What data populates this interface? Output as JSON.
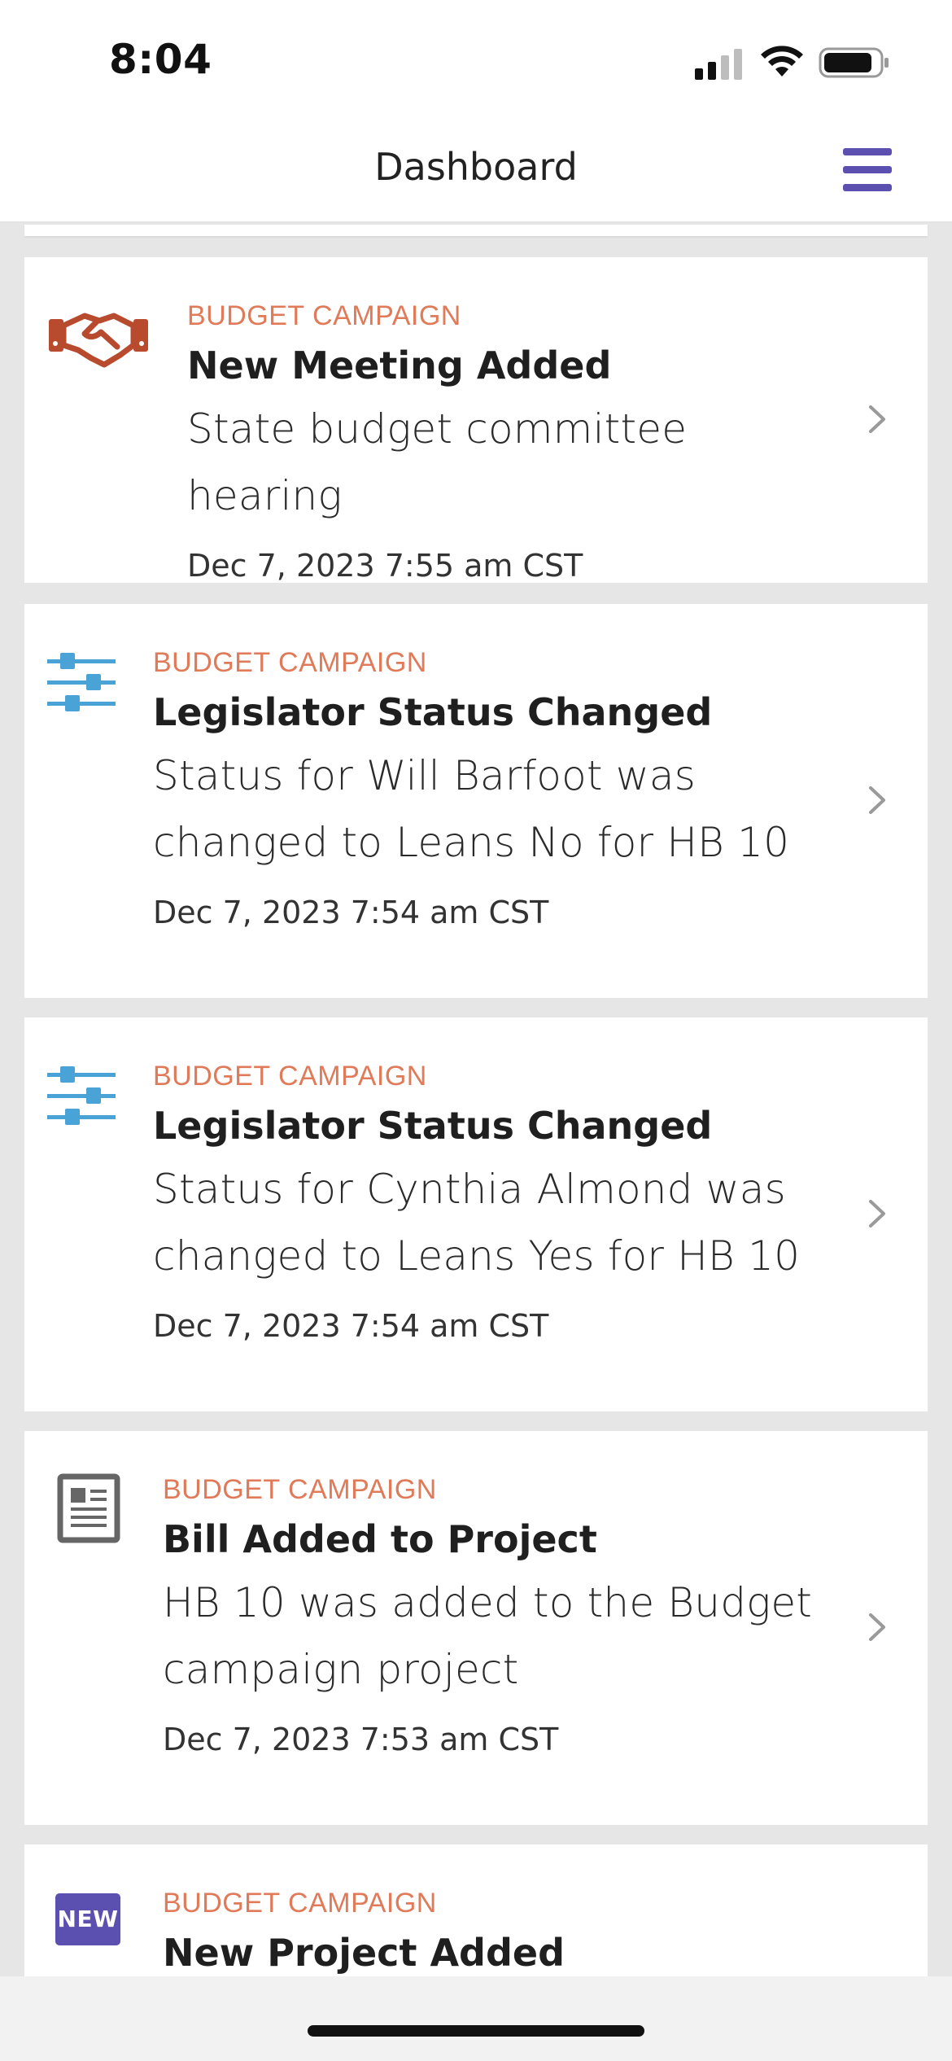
{
  "status_bar": {
    "time": "8:04",
    "icons": [
      "signal-icon",
      "wifi-icon",
      "battery-icon"
    ]
  },
  "nav": {
    "title": "Dashboard",
    "menu_icon": "hamburger-menu-icon",
    "accent_color": "#5b4fb0"
  },
  "feed": {
    "items": [
      {
        "icon": "handshake-icon",
        "category": "BUDGET CAMPAIGN",
        "title": "New Meeting Added",
        "description": "State budget committee hearing",
        "timestamp": "Dec 7, 2023 7:55 am CST"
      },
      {
        "icon": "sliders-icon",
        "category": "BUDGET CAMPAIGN",
        "title": "Legislator Status Changed",
        "description": "Status for Will Barfoot was changed to Leans No for HB 10",
        "timestamp": "Dec 7, 2023 7:54 am CST"
      },
      {
        "icon": "sliders-icon",
        "category": "BUDGET CAMPAIGN",
        "title": "Legislator Status Changed",
        "description": "Status for Cynthia Almond was changed to Leans Yes for HB 10",
        "timestamp": "Dec 7, 2023 7:54 am CST"
      },
      {
        "icon": "document-icon",
        "category": "BUDGET CAMPAIGN",
        "title": "Bill Added to Project",
        "description": "HB 10 was added to the Budget campaign project",
        "timestamp": "Dec 7, 2023 7:53 am CST"
      },
      {
        "icon": "new-badge-icon",
        "badge_text": "NEW",
        "category": "BUDGET CAMPAIGN",
        "title": "New Project Added"
      }
    ]
  },
  "colors": {
    "category": "#e07a58",
    "handshake": "#b84a2e",
    "sliders": "#4aa3d6",
    "document": "#666666",
    "new_badge": "#5b4fb0"
  }
}
